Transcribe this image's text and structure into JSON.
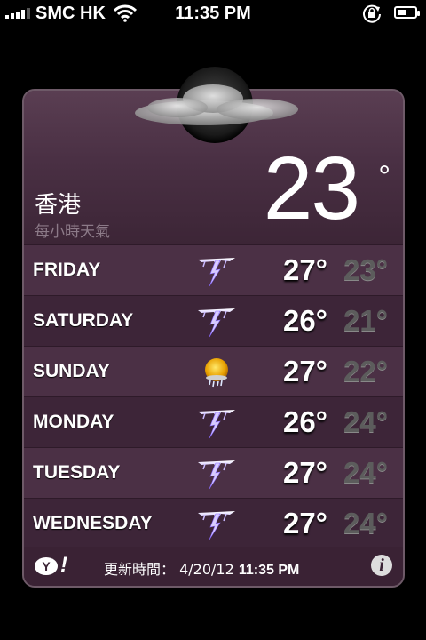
{
  "status_bar": {
    "carrier": "SMC HK",
    "time": "11:35 PM",
    "signal_bars": 4,
    "battery_level": 0.45,
    "icons": [
      "signal-icon",
      "wifi-icon",
      "rotation-lock-icon",
      "battery-icon"
    ]
  },
  "weather": {
    "city": "香港",
    "subtitle": "每小時天氣",
    "current_temp": "23",
    "degree": "°",
    "hero_icon": "moon-cloud-icon",
    "forecast": [
      {
        "day": "FRIDAY",
        "icon": "thunderstorm-icon",
        "high": "27°",
        "low": "23°"
      },
      {
        "day": "SATURDAY",
        "icon": "thunderstorm-icon",
        "high": "26°",
        "low": "21°"
      },
      {
        "day": "SUNDAY",
        "icon": "sun-rain-icon",
        "high": "27°",
        "low": "22°"
      },
      {
        "day": "MONDAY",
        "icon": "thunderstorm-icon",
        "high": "26°",
        "low": "24°"
      },
      {
        "day": "TUESDAY",
        "icon": "thunderstorm-icon",
        "high": "27°",
        "low": "24°"
      },
      {
        "day": "WEDNESDAY",
        "icon": "thunderstorm-icon",
        "high": "27°",
        "low": "24°"
      }
    ],
    "footer": {
      "yahoo_y": "Y",
      "yahoo_bang": "!",
      "updated_label": "更新時間：",
      "updated_date": "4/20/12",
      "updated_time": "11:35 PM",
      "info_label": "i"
    }
  },
  "colors": {
    "card_bg": "#3f2638",
    "row_odd": "#4b3045",
    "row_even": "#3d2538",
    "low_temp": "#5c5c5c"
  }
}
